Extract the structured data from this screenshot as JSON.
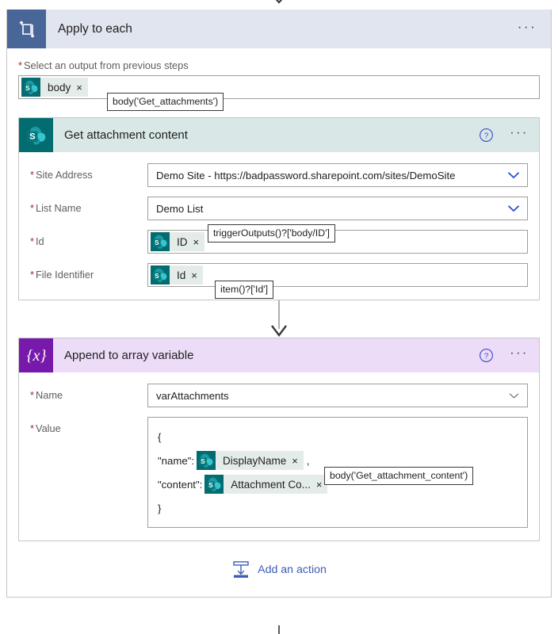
{
  "scope": {
    "title": "Apply to each",
    "icon": "loop-icon",
    "ellipsis_label": "···",
    "output_field": {
      "label": "Select an output from previous steps",
      "required": true,
      "token": {
        "icon": "sharepoint-icon",
        "label": "body",
        "remove_label": "×"
      },
      "tooltip": "body('Get_attachments')"
    }
  },
  "actions": [
    {
      "title": "Get attachment content",
      "icon": "sharepoint-icon",
      "help_label": "?",
      "ellipsis_label": "···",
      "params": [
        {
          "label": "Site Address",
          "required": true,
          "type": "combobox",
          "value": "Demo Site - https://badpassword.sharepoint.com/sites/DemoSite",
          "chevron": "chevron-down-icon"
        },
        {
          "label": "List Name",
          "required": true,
          "type": "combobox",
          "value": "Demo List",
          "chevron": "chevron-down-icon"
        },
        {
          "label": "Id",
          "required": true,
          "type": "token",
          "token": {
            "icon": "sharepoint-icon",
            "label": "ID",
            "remove_label": "×"
          },
          "tooltip": "triggerOutputs()?['body/ID']"
        },
        {
          "label": "File Identifier",
          "required": true,
          "type": "token",
          "token": {
            "icon": "sharepoint-icon",
            "label": "Id",
            "remove_label": "×"
          },
          "tooltip": "item()?['Id']"
        }
      ]
    },
    {
      "title": "Append to array variable",
      "icon": "variable-icon",
      "icon_glyph": "{x}",
      "help_label": "?",
      "ellipsis_label": "···",
      "params": [
        {
          "label": "Name",
          "required": true,
          "type": "combobox",
          "value": "varAttachments",
          "chevron": "chevron-down-icon"
        },
        {
          "label": "Value",
          "required": true,
          "type": "valuebox"
        }
      ],
      "value_lines": [
        {
          "prefix": "{",
          "token": null,
          "suffix": ""
        },
        {
          "prefix": "\"name\":",
          "token": {
            "icon": "sharepoint-icon",
            "label": "DisplayName",
            "remove_label": "×"
          },
          "suffix": ","
        },
        {
          "prefix": "\"content\":",
          "token": {
            "icon": "sharepoint-icon",
            "label": "Attachment Co...",
            "remove_label": "×"
          },
          "suffix": ""
        },
        {
          "prefix": "}",
          "token": null,
          "suffix": ""
        }
      ],
      "value_tooltip": "body('Get_attachment_content')"
    }
  ],
  "add_action": {
    "label": "Add an action",
    "icon": "add-action-icon"
  },
  "colors": {
    "scope_header_bg": "#e1e5ef",
    "scope_icon_bg": "#486698",
    "sharepoint_header_bg": "#d9e8e7",
    "sharepoint_icon_bg": "#036c70",
    "variable_header_bg": "#ecdcf7",
    "variable_icon_bg": "#7719aa",
    "token_bg": "#e4ecea",
    "link_blue": "#3b5cb8",
    "required_red": "#a4262c",
    "chevron_blue": "#2b53d8"
  }
}
